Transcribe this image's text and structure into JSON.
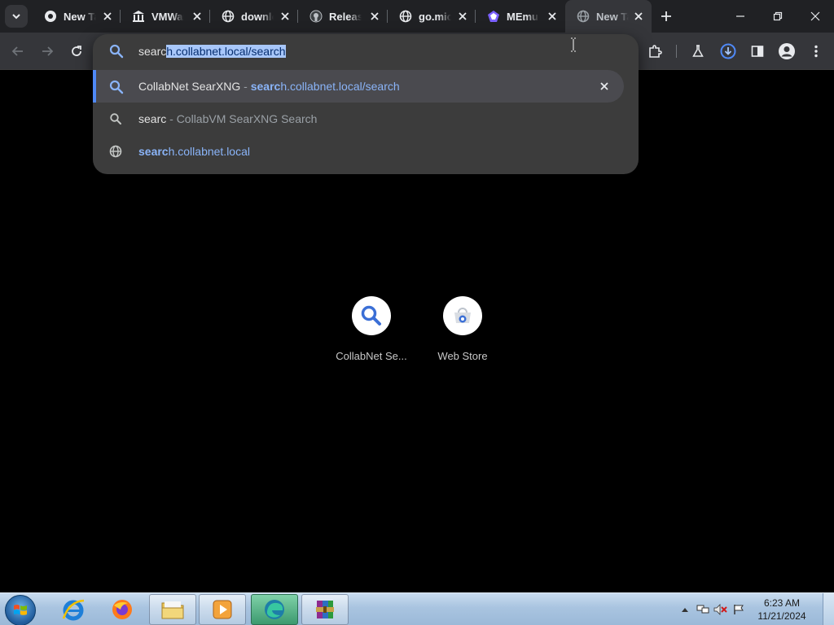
{
  "tabs": [
    {
      "title": "New Tab",
      "icon": "chrome-icon",
      "active": false
    },
    {
      "title": "VMWare",
      "icon": "bank-icon",
      "active": false
    },
    {
      "title": "download",
      "icon": "globe-icon",
      "active": false
    },
    {
      "title": "Releases",
      "icon": "github-icon",
      "active": false
    },
    {
      "title": "go.microsoft",
      "icon": "globe-icon",
      "active": false
    },
    {
      "title": "MEmu",
      "icon": "memu-icon",
      "active": false
    },
    {
      "title": "New Tab",
      "icon": "globe-icon",
      "active": true
    }
  ],
  "omnibox": {
    "typed": "searc",
    "autocomplete": "h.collabnet.local/search",
    "suggestions": [
      {
        "icon": "search-icon",
        "title": "CollabNet SearXNG",
        "sep": " - ",
        "url_match": "searc",
        "url_rest": "h.collabnet.local/search",
        "selected": true
      },
      {
        "icon": "search-icon",
        "title": "searc",
        "sep": " - ",
        "desc": "CollabVM SearXNG Search",
        "selected": false
      },
      {
        "icon": "globe-icon",
        "url_match": "searc",
        "url_rest": "h.collabnet.local",
        "selected": false
      }
    ]
  },
  "shortcuts": [
    {
      "label": "CollabNet Se...",
      "icon": "search-icon"
    },
    {
      "label": "Web Store",
      "icon": "web-store-icon"
    }
  ],
  "taskbar": {
    "apps": [
      "internet-explorer-icon",
      "firefox-icon",
      "file-explorer-icon",
      "media-player-icon",
      "edge-icon",
      "winrar-icon"
    ],
    "time": "6:23 AM",
    "date": "11/21/2024"
  },
  "colors": {
    "accent": "#8ab4f8",
    "selection_bar": "#4f89f7",
    "chrome_dark": "#35363a"
  }
}
